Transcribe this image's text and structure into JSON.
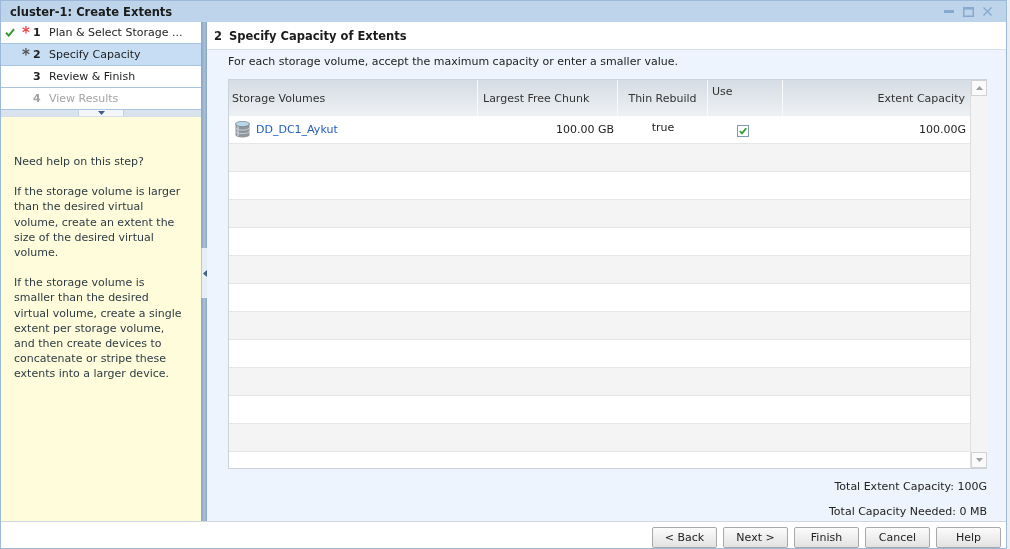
{
  "window": {
    "title": "cluster-1: Create Extents"
  },
  "steps": [
    {
      "number": "1",
      "label": "Plan & Select Storage ...",
      "completed": true,
      "marker": {
        "text": "*",
        "color": "#e8474f"
      },
      "selected": false,
      "disabled": false
    },
    {
      "number": "2",
      "label": "Specify Capacity",
      "completed": false,
      "marker": {
        "text": "*",
        "color": "#555555"
      },
      "selected": true,
      "disabled": false
    },
    {
      "number": "3",
      "label": "Review & Finish",
      "completed": false,
      "selected": false,
      "disabled": false
    },
    {
      "number": "4",
      "label": "View Results",
      "completed": false,
      "selected": false,
      "disabled": true
    }
  ],
  "help": {
    "title": "Need help on this step?",
    "paragraphs": [
      "If the storage volume is larger than the desired virtual volume, create an extent the size of the desired virtual volume.",
      "If the storage volume is smaller than the desired virtual volume, create a single extent per storage volume, and then create devices to concatenate or stripe these extents into a larger device."
    ]
  },
  "page": {
    "step_number": "2",
    "title": "Specify Capacity of Extents",
    "instructions": "For each storage volume, accept the maximum capacity or enter a smaller value."
  },
  "table": {
    "columns": [
      "Storage Volumes",
      "Largest Free Chunk",
      "Thin Rebuild",
      "Use",
      "Extent Capacity"
    ],
    "rows": [
      {
        "volume": "DD_DC1_Aykut",
        "largest_free_chunk": "100.00 GB",
        "thin_rebuild": "true",
        "use": true,
        "extent_capacity": "100.00G"
      }
    ]
  },
  "totals": [
    "Total Extent Capacity: 100G",
    "Total Capacity Needed: 0 MB"
  ],
  "buttons": [
    "< Back",
    "Next >",
    "Finish",
    "Cancel",
    "Help"
  ]
}
